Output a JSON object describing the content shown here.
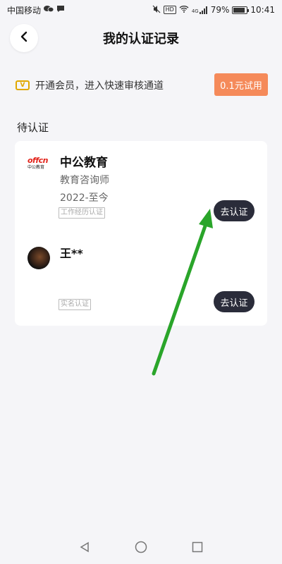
{
  "status_bar": {
    "carrier": "中国移动",
    "hd": "HD",
    "signal": "4G",
    "battery": "79%",
    "time": "10:41"
  },
  "header": {
    "title": "我的认证记录"
  },
  "promo": {
    "vip_label": "V",
    "text": "开通会员，进入快速审核通道",
    "trial_button": "0.1元试用"
  },
  "section": {
    "title": "待认证"
  },
  "records": [
    {
      "logo_text": "offcn",
      "logo_sub": "中公教育",
      "org_name": "中公教育",
      "job_title": "教育咨询师",
      "period": "2022-至今",
      "tag": "工作经历认证",
      "button": "去认证"
    },
    {
      "person_name": "王**",
      "tag": "实名认证",
      "button": "去认证"
    }
  ],
  "colors": {
    "background": "#f5f5f8",
    "trial_button": "#f58a5a",
    "verify_button": "#2a2c3a",
    "arrow": "#2aa52a"
  }
}
